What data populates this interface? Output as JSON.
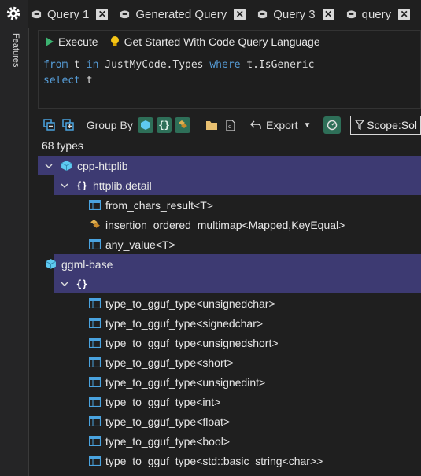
{
  "left_rail": {
    "label": "Features"
  },
  "tabs": [
    {
      "label": "Query 1"
    },
    {
      "label": "Generated Query"
    },
    {
      "label": "Query 3"
    },
    {
      "label": "query"
    }
  ],
  "editor": {
    "execute_label": "Execute",
    "get_started_label": "Get Started With Code Query Language",
    "code_line1": {
      "kw1": "from",
      "t1": " t ",
      "kw2": "in",
      "t2": " JustMyCode.Types ",
      "kw3": "where",
      "t3": " t.IsGeneric"
    },
    "code_line2": {
      "kw1": "select",
      "t1": " t"
    }
  },
  "results_toolbar": {
    "group_by_label": "Group By",
    "export_label": "Export",
    "scope_label": "Scope:Sol"
  },
  "result_count": "68 types",
  "tree": {
    "n1": "cpp-httplib",
    "n1_ns": "httplib.detail",
    "n1_items": [
      "from_chars_result<T>",
      "insertion_ordered_multimap<Mapped,KeyEqual>",
      "any_value<T>"
    ],
    "n2": "ggml-base",
    "n2_items": [
      "type_to_gguf_type<unsignedchar>",
      "type_to_gguf_type<signedchar>",
      "type_to_gguf_type<unsignedshort>",
      "type_to_gguf_type<short>",
      "type_to_gguf_type<unsignedint>",
      "type_to_gguf_type<int>",
      "type_to_gguf_type<float>",
      "type_to_gguf_type<bool>",
      "type_to_gguf_type<std::basic_string<char>>"
    ]
  },
  "colors": {
    "selection": "#3d3a72",
    "accent_green": "#2e6f58",
    "keyword": "#569cd6"
  }
}
